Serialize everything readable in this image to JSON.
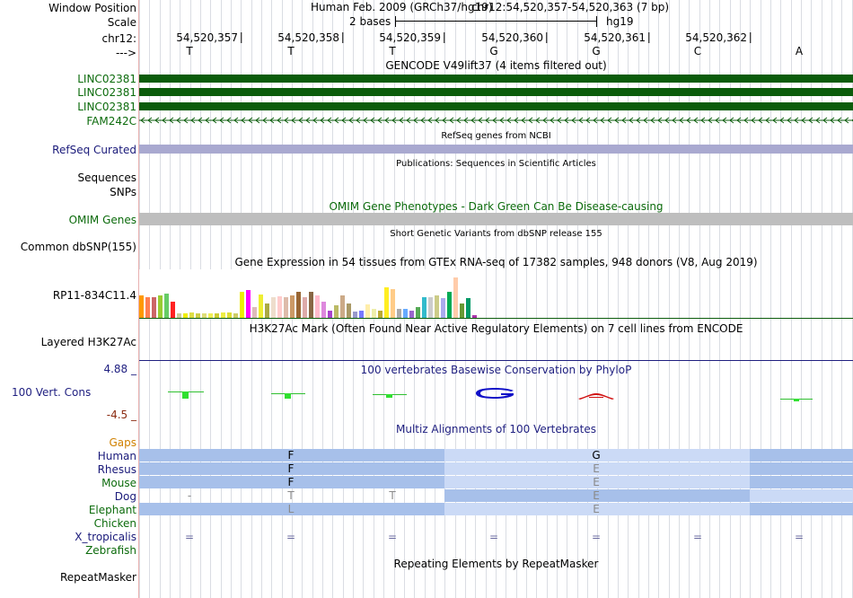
{
  "header": {
    "window_position_label": "Window Position",
    "scale_label": "Scale",
    "chr_label": "chr12:",
    "strand_label": "--->",
    "assembly": "Human Feb. 2009 (GRCh37/hg19)",
    "position": "chr12:54,520,357-54,520,363 (7 bp)",
    "scale_text": "2 bases",
    "scale_db": "hg19"
  },
  "ruler": {
    "positions": [
      "54,520,357",
      "54,520,358",
      "54,520,359",
      "54,520,360",
      "54,520,361",
      "54,520,362"
    ],
    "bases": [
      "T",
      "T",
      "T",
      "G",
      "G",
      "C",
      "A"
    ]
  },
  "tracks": {
    "gencode_title": "GENCODE V49lift37 (4 items filtered out)",
    "gencode_items": [
      "LINC02381",
      "LINC02381",
      "LINC02381",
      "FAM242C"
    ],
    "refseq_title": "RefSeq genes from NCBI",
    "refseq_label": "RefSeq Curated",
    "pubs_title": "Publications: Sequences in Scientific Articles",
    "sequences_label": "Sequences",
    "snps_label": "SNPs",
    "omim_title": "OMIM Gene Phenotypes - Dark Green Can Be Disease-causing",
    "omim_label": "OMIM Genes",
    "dbsnp_title": "Short Genetic Variants from dbSNP release 155",
    "dbsnp_label": "Common dbSNP(155)",
    "gtex_title": "Gene Expression in 54 tissues from GTEx RNA-seq of 17382 samples, 948 donors (V8, Aug 2019)",
    "gtex_label": "RP11-834C11.4",
    "h3k27_title": "H3K27Ac Mark (Often Found Near Active Regulatory Elements) on 7 cell lines from ENCODE",
    "h3k27_label": "Layered H3K27Ac",
    "cons_title": "100 vertebrates Basewise Conservation by PhyloP",
    "cons_label": "100 Vert. Cons",
    "cons_max": "4.88 _",
    "cons_min": "-4.5 _",
    "multiz_title": "Multiz Alignments of 100 Vertebrates",
    "repeat_title": "Repeating Elements by RepeatMasker",
    "repeat_label": "RepeatMasker"
  },
  "multiz": {
    "gaps_label": "Gaps",
    "species": [
      "Human",
      "Rhesus",
      "Mouse",
      "Dog",
      "Elephant",
      "Chicken",
      "X_tropicalis",
      "Zebrafish"
    ],
    "letters": [
      [
        "F",
        "G"
      ],
      [
        "F",
        "E"
      ],
      [
        "F",
        "E"
      ],
      [
        "-",
        "T",
        "T",
        "E"
      ],
      [
        "L",
        "E"
      ],
      [],
      [
        "=",
        "=",
        "=",
        "=",
        "=",
        "=",
        "="
      ],
      []
    ]
  },
  "colors": {
    "gencode_green": "#0b5c0b",
    "refseq": "#a9a9d0",
    "omim": "#bebebe",
    "label_blue": "#1a1a7a",
    "label_green": "#0c6b0c",
    "label_orange": "#d08000",
    "cons_max": "#1f1f80",
    "cons_min": "#8a2a10",
    "multiz_dark": "#a7c0ea",
    "multiz_light": "#cbdaf6"
  },
  "gtex_values": [
    0.47,
    0.43,
    0.43,
    0.47,
    0.5,
    0.33,
    0.1,
    0.09,
    0.12,
    0.09,
    0.09,
    0.09,
    0.09,
    0.12,
    0.12,
    0.1,
    0.53,
    0.58,
    0.23,
    0.48,
    0.3,
    0.43,
    0.44,
    0.43,
    0.47,
    0.53,
    0.43,
    0.53,
    0.47,
    0.33,
    0.14,
    0.25,
    0.46,
    0.3,
    0.13,
    0.14,
    0.27,
    0.19,
    0.14,
    0.63,
    0.6,
    0.18,
    0.19,
    0.15,
    0.23,
    0.43,
    0.43,
    0.46,
    0.4,
    0.53,
    0.83,
    0.3,
    0.4,
    0.06
  ]
}
